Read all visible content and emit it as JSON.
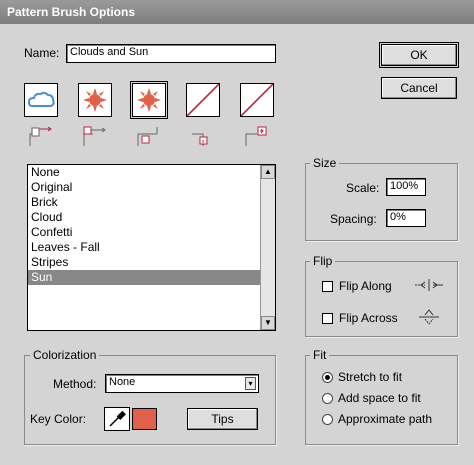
{
  "dialog": {
    "title": "Pattern Brush Options"
  },
  "name": {
    "label": "Name:",
    "value": "Clouds and Sun"
  },
  "buttons": {
    "ok": "OK",
    "cancel": "Cancel",
    "tips": "Tips"
  },
  "tiles": [
    {
      "name": "side-tile",
      "icon": "cloud-icon"
    },
    {
      "name": "outer-corner-tile",
      "icon": "sun-icon"
    },
    {
      "name": "inner-corner-tile",
      "icon": "sun-icon",
      "selected": true
    },
    {
      "name": "start-tile",
      "icon": "none-slash-icon"
    },
    {
      "name": "end-tile",
      "icon": "none-slash-icon"
    }
  ],
  "patterns": [
    {
      "label": "None"
    },
    {
      "label": "Original"
    },
    {
      "label": "Brick"
    },
    {
      "label": "Cloud"
    },
    {
      "label": "Confetti"
    },
    {
      "label": "Leaves - Fall"
    },
    {
      "label": "Stripes"
    },
    {
      "label": "Sun",
      "selected": true
    }
  ],
  "size": {
    "legend": "Size",
    "scale_label": "Scale:",
    "scale_value": "100%",
    "spacing_label": "Spacing:",
    "spacing_value": "0%"
  },
  "flip": {
    "legend": "Flip",
    "along_label": "Flip Along",
    "across_label": "Flip Across"
  },
  "fit": {
    "legend": "Fit",
    "options": [
      "Stretch to fit",
      "Add space to fit",
      "Approximate path"
    ],
    "selected": 0
  },
  "colorization": {
    "legend": "Colorization",
    "method_label": "Method:",
    "method_value": "None",
    "key_color_label": "Key Color:",
    "key_color": "#e0604a"
  },
  "colors": {
    "sun": "#e0604a",
    "cloud": "#4a90d0",
    "slash": "#c0203a",
    "titlebar": "#8a8a8a"
  }
}
